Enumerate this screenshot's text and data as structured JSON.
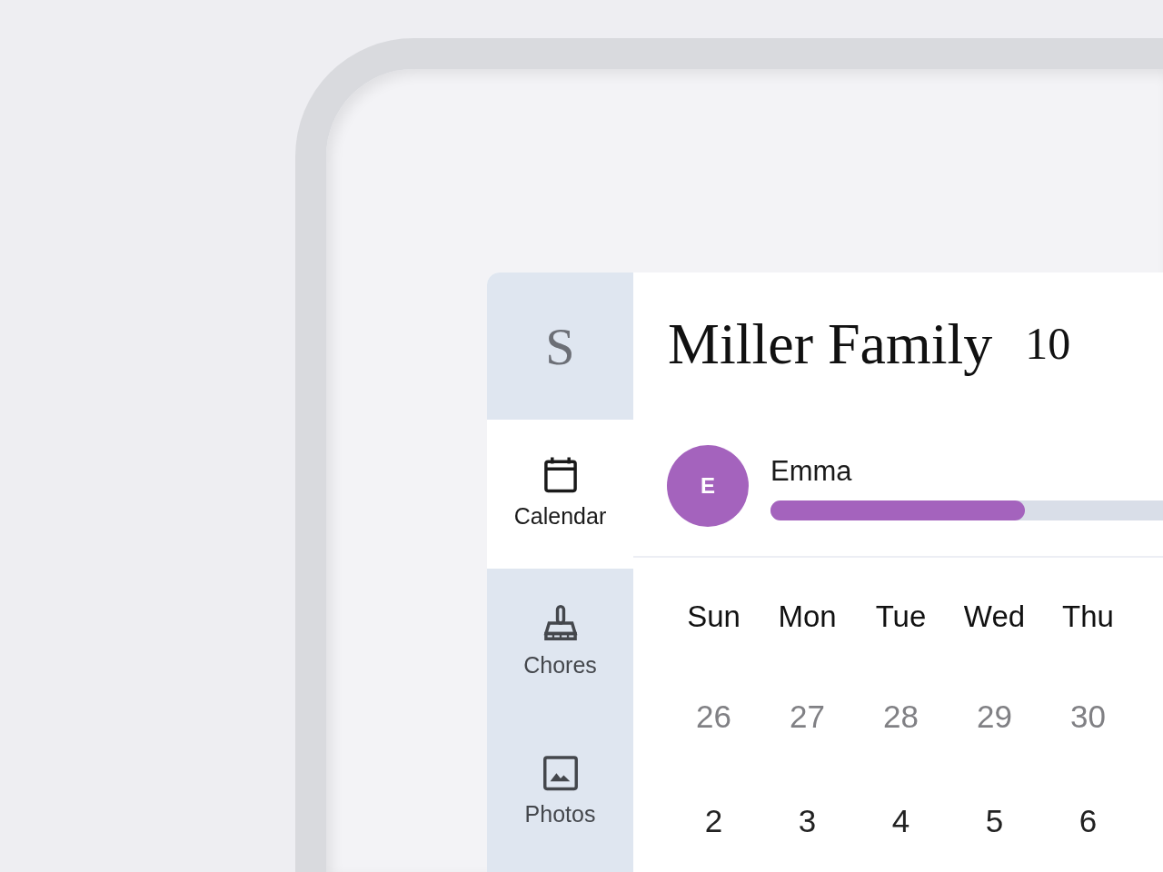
{
  "sidebar": {
    "logo": "S",
    "items": [
      {
        "label": "Calendar",
        "selected": true
      },
      {
        "label": "Chores",
        "selected": false
      },
      {
        "label": "Photos",
        "selected": false
      }
    ]
  },
  "header": {
    "title": "Miller Family",
    "date": "10"
  },
  "members": [
    {
      "initial": "E",
      "name": "Emma",
      "color": "#a463bd",
      "level": 0.56
    }
  ],
  "calendar": {
    "weekdays": [
      "Sun",
      "Mon",
      "Tue",
      "Wed",
      "Thu"
    ],
    "weeks": [
      [
        {
          "day": "26",
          "muted": true
        },
        {
          "day": "27",
          "muted": true
        },
        {
          "day": "28",
          "muted": true
        },
        {
          "day": "29",
          "muted": true
        },
        {
          "day": "30",
          "muted": true
        }
      ],
      [
        {
          "day": "2",
          "muted": false
        },
        {
          "day": "3",
          "muted": false
        },
        {
          "day": "4",
          "muted": false
        },
        {
          "day": "5",
          "muted": false
        },
        {
          "day": "6",
          "muted": false
        }
      ]
    ]
  }
}
